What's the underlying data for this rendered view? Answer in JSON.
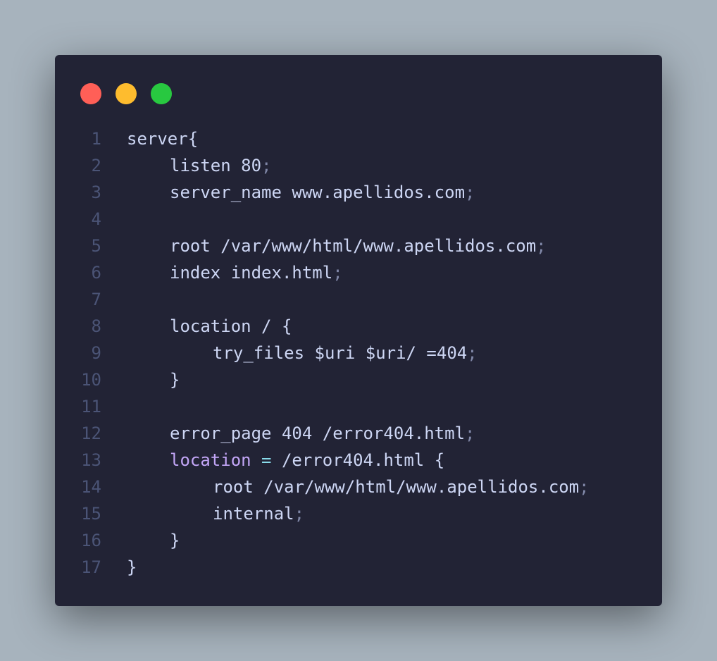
{
  "window": {
    "controls": {
      "close": "#ff5f57",
      "minimize": "#febc2e",
      "maximize": "#28c840"
    }
  },
  "code": {
    "lines": [
      {
        "n": "1",
        "indent": 0,
        "tokens": [
          {
            "t": "server{",
            "c": "txt"
          }
        ]
      },
      {
        "n": "2",
        "indent": 1,
        "tokens": [
          {
            "t": "listen 80",
            "c": "txt"
          },
          {
            "t": ";",
            "c": "punct"
          }
        ]
      },
      {
        "n": "3",
        "indent": 1,
        "tokens": [
          {
            "t": "server_name www.apellidos.com",
            "c": "txt"
          },
          {
            "t": ";",
            "c": "punct"
          }
        ]
      },
      {
        "n": "4",
        "indent": 0,
        "tokens": []
      },
      {
        "n": "5",
        "indent": 1,
        "tokens": [
          {
            "t": "root /var/www/html/www.apellidos.com",
            "c": "txt"
          },
          {
            "t": ";",
            "c": "punct"
          }
        ]
      },
      {
        "n": "6",
        "indent": 1,
        "tokens": [
          {
            "t": "index index.html",
            "c": "txt"
          },
          {
            "t": ";",
            "c": "punct"
          }
        ]
      },
      {
        "n": "7",
        "indent": 0,
        "tokens": []
      },
      {
        "n": "8",
        "indent": 1,
        "tokens": [
          {
            "t": "location / {",
            "c": "txt"
          }
        ]
      },
      {
        "n": "9",
        "indent": 2,
        "tokens": [
          {
            "t": "try_files $uri $uri/ =404",
            "c": "txt"
          },
          {
            "t": ";",
            "c": "punct"
          }
        ]
      },
      {
        "n": "10",
        "indent": 1,
        "tokens": [
          {
            "t": "}",
            "c": "txt"
          }
        ]
      },
      {
        "n": "11",
        "indent": 0,
        "tokens": []
      },
      {
        "n": "12",
        "indent": 1,
        "tokens": [
          {
            "t": "error_page 404 /error404.html",
            "c": "txt"
          },
          {
            "t": ";",
            "c": "punct"
          }
        ]
      },
      {
        "n": "13",
        "indent": 1,
        "tokens": [
          {
            "t": "location",
            "c": "kw"
          },
          {
            "t": " ",
            "c": "txt"
          },
          {
            "t": "=",
            "c": "op"
          },
          {
            "t": " /error404.html {",
            "c": "txt"
          }
        ]
      },
      {
        "n": "14",
        "indent": 2,
        "tokens": [
          {
            "t": "root /var/www/html/www.apellidos.com",
            "c": "txt"
          },
          {
            "t": ";",
            "c": "punct"
          }
        ]
      },
      {
        "n": "15",
        "indent": 2,
        "tokens": [
          {
            "t": "internal",
            "c": "txt"
          },
          {
            "t": ";",
            "c": "punct"
          }
        ]
      },
      {
        "n": "16",
        "indent": 1,
        "tokens": [
          {
            "t": "}",
            "c": "txt"
          }
        ]
      },
      {
        "n": "17",
        "indent": 0,
        "tokens": [
          {
            "t": "}",
            "c": "txt"
          }
        ]
      }
    ]
  }
}
